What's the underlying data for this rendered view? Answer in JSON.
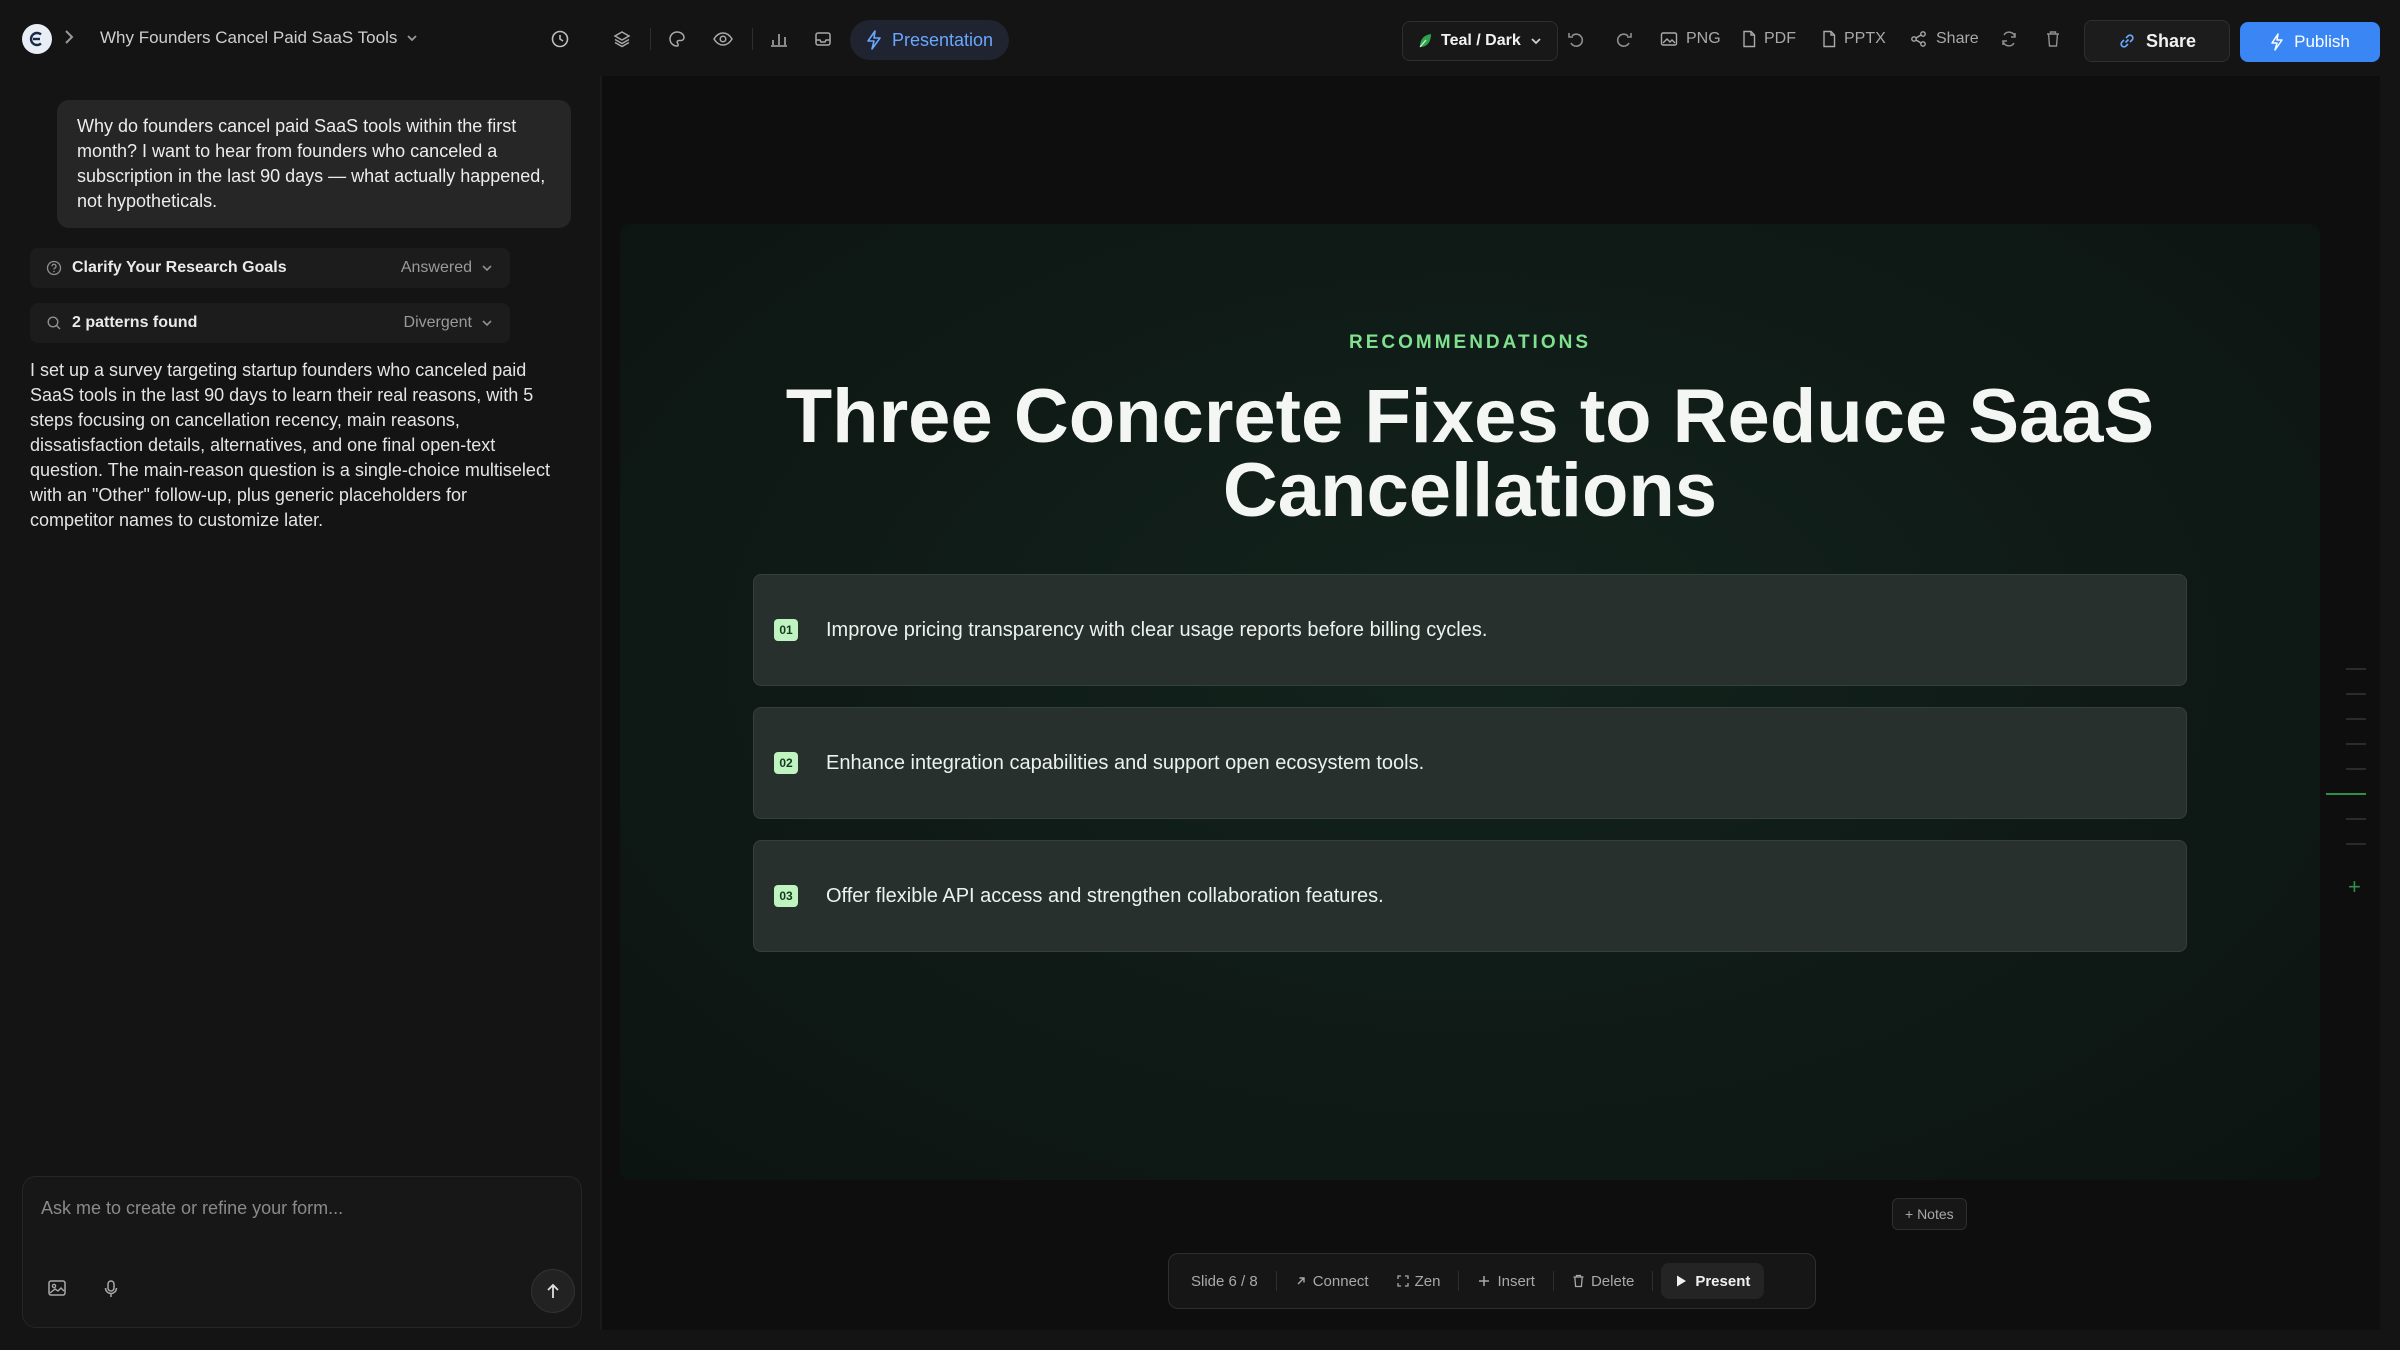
{
  "header": {
    "doc_title": "Why Founders Cancel Paid SaaS Tools",
    "presentation_label": "Presentation",
    "theme_label": "Teal / Dark",
    "png_label": "PNG",
    "pdf_label": "PDF",
    "pptx_label": "PPTX",
    "share_small_label": "Share",
    "share_label": "Share",
    "publish_label": "Publish"
  },
  "chat": {
    "user_message": "Why do founders cancel paid SaaS tools within the first month? I want to hear from founders who canceled a subscription in the last 90 days — what actually happened, not hypotheticals.",
    "steps": [
      {
        "label": "Clarify Your Research Goals",
        "status": "Answered",
        "icon": "help-circle-icon"
      },
      {
        "label": "2 patterns found",
        "status": "Divergent",
        "icon": "search-icon"
      }
    ],
    "assistant_message": "I set up a survey targeting startup founders who canceled paid SaaS tools in the last 90 days to learn their real reasons, with 5 steps focusing on cancellation recency, main reasons, dissatisfaction details, alternatives, and one final open-text question. The main-reason question is a single-choice multiselect with an \"Other\" follow-up, plus generic placeholders for competitor names to customize later.",
    "composer_placeholder": "Ask me to create or refine your form..."
  },
  "slide": {
    "eyebrow": "RECOMMENDATIONS",
    "title": "Three Concrete Fixes to Reduce SaaS Cancellations",
    "items": [
      {
        "num": "01",
        "text": "Improve pricing transparency with clear usage reports before billing cycles."
      },
      {
        "num": "02",
        "text": "Enhance integration capabilities and support open ecosystem tools."
      },
      {
        "num": "03",
        "text": "Offer flexible API access and strengthen collaboration features."
      }
    ],
    "accent": "#7fe08f"
  },
  "footer": {
    "notes_label": "+ Notes",
    "slide_counter": "Slide 6 / 8",
    "connect_label": "Connect",
    "zen_label": "Zen",
    "insert_label": "Insert",
    "delete_label": "Delete",
    "present_label": "Present"
  }
}
